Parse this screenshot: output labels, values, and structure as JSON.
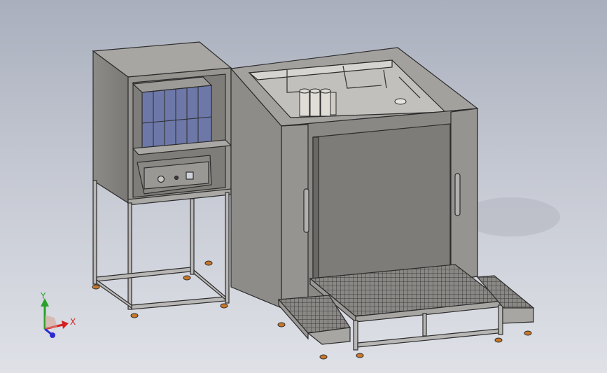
{
  "viewport": {
    "background_top": "#a9afbd",
    "background_bottom": "#dfe1e7"
  },
  "colors": {
    "body_gray": "#8c8a87",
    "body_gray_light": "#a3a19e",
    "body_gray_dark": "#6f6d6a",
    "edge_black": "#2c2c2c",
    "frame_gray": "#b8b7b5",
    "axis_x": "#d42020",
    "axis_y": "#2aa02a",
    "axis_z": "#2b2bd0",
    "foot_orange": "#c8782a",
    "screen_blue": "#6d78a8"
  },
  "triad": {
    "x_label": "X",
    "y_label": "Y"
  },
  "icons": {
    "triad": "coordinate-triad-icon"
  }
}
